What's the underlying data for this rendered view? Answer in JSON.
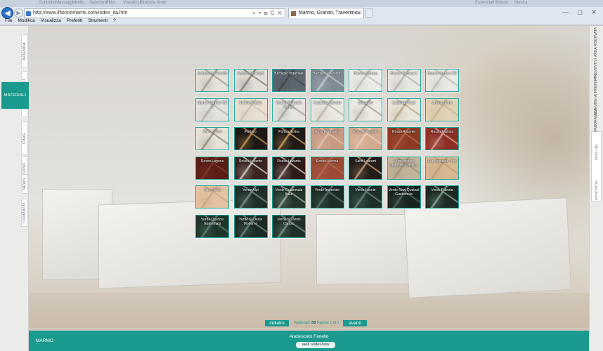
{
  "browser": {
    "top_strip": [
      "Controllo",
      "Messaggio",
      "Livello",
      "Selezione",
      "Filtro",
      "Visualizza",
      "Finestra",
      "Aiuto"
    ],
    "top_right": [
      "Essenziali",
      "Sfondo",
      "Mostra"
    ],
    "url": "http://www.ilfiorinomarmi.com/index_ita.htm",
    "url_tools": "⌕ ▾ ⊠ C ✕",
    "tab_title": "Marmo, Granito, Travertino...",
    "window_controls": "— ◻ ✕"
  },
  "menu": [
    "File",
    "Modifica",
    "Visualizza",
    "Preferiti",
    "Strumenti",
    "?"
  ],
  "left_tabs": [
    {
      "label": "AZIENDA"
    },
    {
      "label": "ITEM SPECIALI"
    },
    {
      "label": "MATERIALI"
    },
    {
      "label": "CAVE"
    },
    {
      "label": "MAGAZZINO"
    },
    {
      "label": "NEWS"
    },
    {
      "label": "CONTATTI"
    }
  ],
  "right_tabs": [
    {
      "label": "AREA RISERVATA"
    },
    {
      "label": "PREVENTIVI"
    },
    {
      "label": "AGGIUNGI AI PREFERITI"
    },
    {
      "label": "PANORAMICA"
    }
  ],
  "right_search": "cerca • go",
  "right_bottom": "social corner",
  "gallery": {
    "tiles": [
      {
        "label": "Arabescato Fanello",
        "color": "#e6e2da",
        "vein": "#9a9590"
      },
      {
        "label": "Arabescato Vagli",
        "color": "#e2ded7",
        "vein": "#7d7873"
      },
      {
        "label": "Bardiglio Imperiale",
        "color": "#5d6770",
        "vein": "#3e464d"
      },
      {
        "label": "Bardiglio Nuvolato",
        "color": "#7f8a93",
        "vein": "#c5ccd2"
      },
      {
        "label": "Bianco Carrara",
        "color": "#ecebe8",
        "vein": "#b9b7b2"
      },
      {
        "label": "Bianco Carrara C",
        "color": "#e7e6e3",
        "vein": "#b2afaa"
      },
      {
        "label": "Bianco Carrara CD",
        "color": "#e9e8e5",
        "vein": "#bbb8b3"
      },
      {
        "label": "Bianco Carrara CD Z",
        "color": "#e3e2df",
        "vein": "#adaaa5"
      },
      {
        "label": "Bianco Perlato",
        "color": "#e8dfd2",
        "vein": "#cbbfae"
      },
      {
        "label": "Bianco Statuario Venato",
        "color": "#e5e4e1",
        "vein": "#9f9b96"
      },
      {
        "label": "Calacatta Carrara",
        "color": "#ebe8e2",
        "vein": "#b8b0a3"
      },
      {
        "label": "Calacatta",
        "color": "#ece9e3",
        "vein": "#a39c91"
      },
      {
        "label": "Calacatta Vagli",
        "color": "#e9e4da",
        "vein": "#b39f7e"
      },
      {
        "label": "Crema Siena",
        "color": "#e0d2b6",
        "vein": "#c7b38d"
      },
      {
        "label": "Giallo Siena",
        "color": "#e7e2d8",
        "vein": "#8f8576"
      },
      {
        "label": "Portoro",
        "color": "#1c1816",
        "vein": "#c79a52"
      },
      {
        "label": "Portoro Extra",
        "color": "#201a17",
        "vein": "#d4a560"
      },
      {
        "label": "Rosa Portogallo",
        "color": "#c89a82",
        "vein": "#e2c3b1"
      },
      {
        "label": "Rosa Portogallo",
        "color": "#d3aa8e",
        "vein": "#ebcfbd"
      },
      {
        "label": "Rosso Alicante",
        "color": "#8b3a22",
        "vein": "#b9684c"
      },
      {
        "label": "Rosso Francia",
        "color": "#8d2f24",
        "vein": "#d9a39a"
      },
      {
        "label": "Rosso Laguna",
        "color": "#5a1e16",
        "vein": "#7e3a2e"
      },
      {
        "label": "Rosso Levanto",
        "color": "#3b2320",
        "vein": "#d8d2cc"
      },
      {
        "label": "Rosso Levanto",
        "color": "#2e1b19",
        "vein": "#cfc6bf"
      },
      {
        "label": "Rosso Verona",
        "color": "#9a4a35",
        "vein": "#b86a52"
      },
      {
        "label": "Saint Laurent",
        "color": "#231c19",
        "vein": "#c7a27a"
      },
      {
        "label": "Serpeggiante Statuario Classico",
        "color": "#c2b49c",
        "vein": "#9d8d74"
      },
      {
        "label": "Serpeggiante Toro",
        "color": "#d6b893",
        "vein": "#bb9a74"
      },
      {
        "label": "Tino Fiorito",
        "color": "#e2c2a0",
        "vein": "#cba27d"
      },
      {
        "label": "Verde Alpi",
        "color": "#1f2e29",
        "vein": "#7e958c"
      },
      {
        "label": "Verde Guatemala Italia",
        "color": "#22352c",
        "vein": "#9fb4a6"
      },
      {
        "label": "Verde Imperiale",
        "color": "#1c2c26",
        "vein": "#5f7a6d"
      },
      {
        "label": "Verde Issorie",
        "color": "#1e302a",
        "vein": "#6d8a7d"
      },
      {
        "label": "Verde New Quetzal Guatemala",
        "color": "#17241f",
        "vein": "#4f6a5e"
      },
      {
        "label": "Verde Patrizia",
        "color": "#1b2a22",
        "vein": "#8ca99a"
      },
      {
        "label": "Verde Quetzal Guatemala",
        "color": "#1f352b",
        "vein": "#5e8170"
      },
      {
        "label": "Verde St Denis Moderno",
        "color": "#1a2a24",
        "vein": "#6b8a7c"
      },
      {
        "label": "Verde St Denis Classic",
        "color": "#1d2f27",
        "vein": "#7b9889"
      }
    ]
  },
  "pager": {
    "prev": "indietro",
    "next": "avanti",
    "info_prefix": "Materiali:",
    "count": "38",
    "info_suffix": "Pagina 1 di 1"
  },
  "footer": {
    "section": "MARMO",
    "caption": "Arabescato Fanello",
    "slideshow": "vedi slideshow"
  },
  "colors": {
    "accent": "#1a9a8f",
    "tile_border": "#1fa89b"
  }
}
